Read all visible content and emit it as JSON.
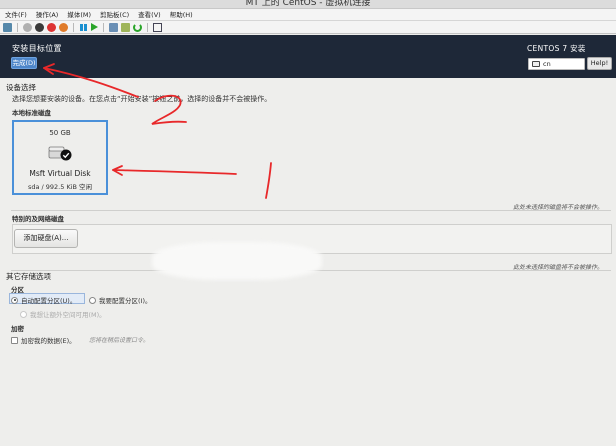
{
  "window": {
    "title": "MT 上的 CentOS - 虚拟机连接"
  },
  "menu": {
    "items": [
      {
        "label": "文件(F)"
      },
      {
        "label": "操作(A)"
      },
      {
        "label": "媒体(M)"
      },
      {
        "label": "剪贴板(C)"
      },
      {
        "label": "查看(V)"
      },
      {
        "label": "帮助(H)"
      }
    ]
  },
  "toolbar": {
    "icons": [
      "ctrl-alt-del-icon",
      "start-icon",
      "turnoff-icon",
      "shutdown-icon",
      "save-state-icon",
      "pause-icon",
      "reset-icon",
      "checkpoint-icon",
      "revert-icon",
      "undo-icon",
      "fullscreen-icon"
    ]
  },
  "header": {
    "title": "安装目标位置",
    "done_label": "完成(D)",
    "product": "CENTOS 7 安装",
    "keyboard_layout": "cn",
    "help_label": "Help!"
  },
  "device_selection": {
    "title": "设备选择",
    "description": "选择您想要安装的设备。在您点击“开始安装”按钮之前，选择的设备并不会被操作。",
    "local_disks_label": "本地标准磁盘",
    "disk": {
      "size": "50 GB",
      "name": "Msft Virtual Disk",
      "info": "sda  /  992.5 KiB 空闲"
    },
    "local_note": "此处未选择的磁盘将不会被操作。",
    "special_disks_label": "特别的及网络磁盘",
    "add_disk_label": "添加硬盘(A)...",
    "special_note": "此处未选择的磁盘将不会被操作。"
  },
  "other_storage": {
    "title": "其它存储选项",
    "partition_label": "分区",
    "auto_partition_label": "自动配置分区(U)。",
    "manual_partition_label": "我要配置分区(I)。",
    "extra_space_label": "我想让额外空间可用(M)。",
    "encryption_label": "加密",
    "encrypt_data_label": "加密我的数据(E)。",
    "encrypt_hint": "您将在稍后设置口令。"
  },
  "colors": {
    "header_bg": "#1e2838",
    "accent_blue": "#4a90d9",
    "annotation_red": "#e8282a"
  }
}
